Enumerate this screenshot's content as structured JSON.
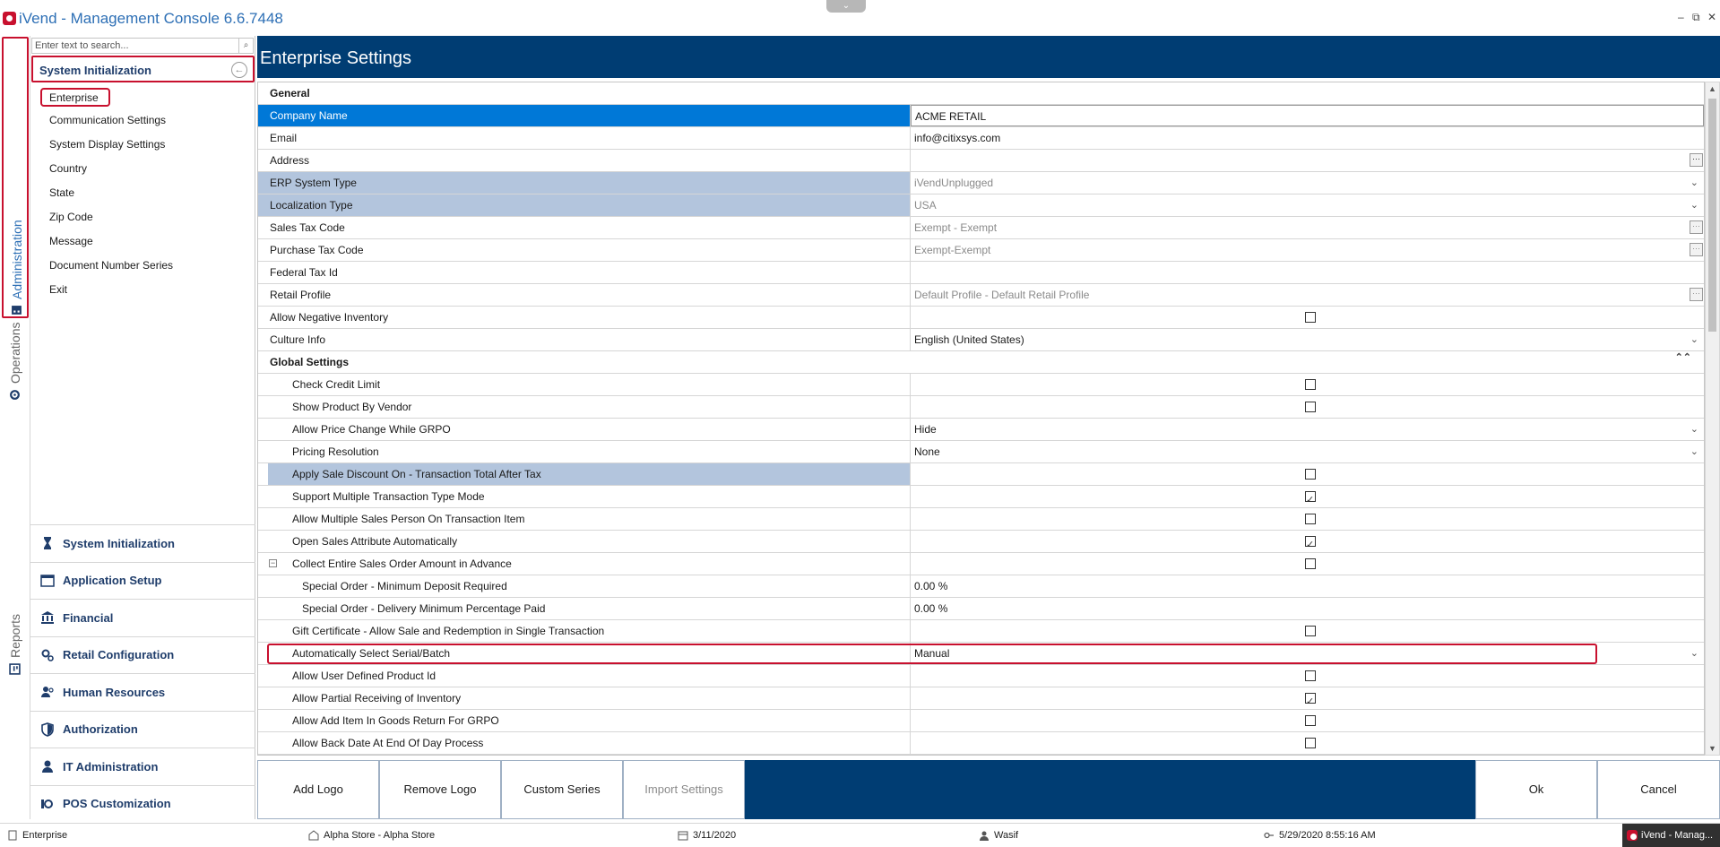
{
  "window": {
    "title": "iVend - Management Console  6.6.7448",
    "minimize": "–",
    "restore": "⧉",
    "close": "✕"
  },
  "rail": {
    "administration": "Administration",
    "operations": "Operations",
    "reports": "Reports"
  },
  "nav": {
    "search_placeholder": "Enter text to search...",
    "section_title": "System Initialization",
    "items": [
      "Enterprise",
      "Communication Settings",
      "System Display Settings",
      "Country",
      "State",
      "Zip Code",
      "Message",
      "Document Number Series",
      "Exit"
    ],
    "groups": [
      "System Initialization",
      "Application Setup",
      "Financial",
      "Retail Configuration",
      "Human Resources",
      "Authorization",
      "IT Administration",
      "POS Customization"
    ]
  },
  "main": {
    "title": "Enterprise Settings",
    "general_section": "General",
    "global_section": "Global Settings",
    "general_rows": [
      {
        "name": "Company Name",
        "value": "ACME RETAIL"
      },
      {
        "name": "Email",
        "value": "info@citixsys.com"
      },
      {
        "name": "Address",
        "value": ""
      },
      {
        "name": "ERP System Type",
        "value": "iVendUnplugged"
      },
      {
        "name": "Localization Type",
        "value": "USA"
      },
      {
        "name": "Sales Tax Code",
        "value": "Exempt - Exempt"
      },
      {
        "name": "Purchase Tax Code",
        "value": "Exempt-Exempt"
      },
      {
        "name": "Federal Tax Id",
        "value": ""
      },
      {
        "name": "Retail Profile",
        "value": "Default Profile - Default Retail Profile"
      },
      {
        "name": "Allow Negative Inventory",
        "value": ""
      },
      {
        "name": "Culture Info",
        "value": "English (United States)"
      }
    ],
    "global_rows": [
      {
        "name": "Check Credit Limit",
        "value": ""
      },
      {
        "name": "Show Product By Vendor",
        "value": ""
      },
      {
        "name": "Allow Price Change While GRPO",
        "value": "Hide"
      },
      {
        "name": "Pricing Resolution",
        "value": "None"
      },
      {
        "name": "Apply Sale Discount On - Transaction Total After Tax",
        "value": ""
      },
      {
        "name": "Support Multiple Transaction Type Mode",
        "value": ""
      },
      {
        "name": "Allow Multiple Sales Person On Transaction Item",
        "value": ""
      },
      {
        "name": "Open Sales Attribute Automatically",
        "value": ""
      },
      {
        "name": "Collect Entire Sales Order Amount in Advance",
        "value": ""
      },
      {
        "name": "Special Order - Minimum Deposit Required",
        "value": "0.00 %"
      },
      {
        "name": "Special Order - Delivery Minimum Percentage Paid",
        "value": "0.00 %"
      },
      {
        "name": "Gift Certificate - Allow Sale and Redemption in Single Transaction",
        "value": ""
      },
      {
        "name": "Automatically Select Serial/Batch",
        "value": "Manual"
      },
      {
        "name": "Allow User Defined Product Id",
        "value": ""
      },
      {
        "name": "Allow Partial Receiving of Inventory",
        "value": ""
      },
      {
        "name": "Allow Add Item In Goods Return For GRPO",
        "value": ""
      },
      {
        "name": "Allow Back Date At End Of Day Process",
        "value": ""
      }
    ]
  },
  "footer": {
    "add_logo": "Add Logo",
    "remove_logo": "Remove Logo",
    "custom_series": "Custom Series",
    "import_settings": "Import Settings",
    "ok": "Ok",
    "cancel": "Cancel"
  },
  "status": {
    "module": "Enterprise",
    "store": "Alpha Store - Alpha Store",
    "date": "3/11/2020",
    "user": "Wasif",
    "datetime": "5/29/2020 8:55:16 AM",
    "taskbar": "iVend - Manag..."
  },
  "colors": {
    "header_blue": "#003d73",
    "selected_row": "#0078d7",
    "highlight_row": "#b3c5dd",
    "annotation_red": "#c8102e"
  }
}
